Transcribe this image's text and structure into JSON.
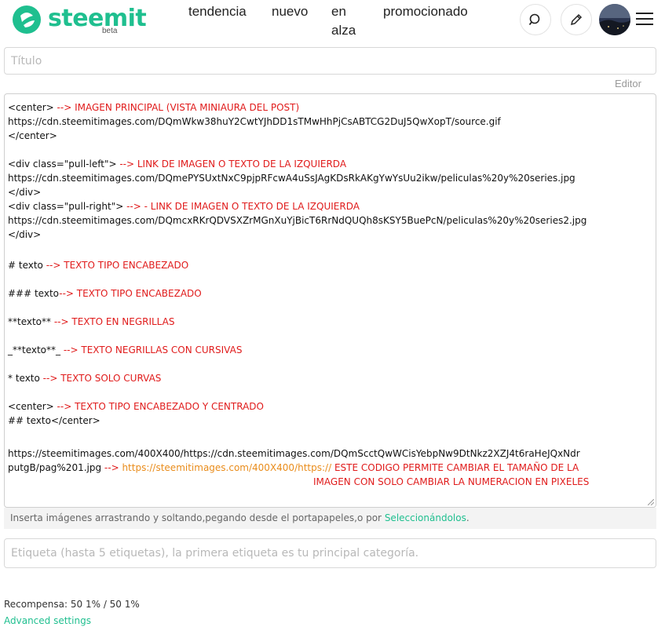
{
  "header": {
    "logo_text": "steemit",
    "logo_beta": "beta",
    "nav": [
      "tendencia",
      "nuevo",
      "en",
      "alza",
      "promocionado"
    ],
    "icons": [
      "search-icon",
      "pencil-icon",
      "avatar",
      "menu-icon"
    ]
  },
  "form": {
    "title_placeholder": "Título",
    "editor_label": "Editor",
    "body_lines": [
      {
        "plain": "<center>",
        "red": " --> IMAGEN PRINCIPAL (VISTA MINIAURA DEL POST)"
      },
      {
        "plain": "https://cdn.steemitimages.com/DQmWkw38huY2CwtYJhDD1sTMwHhPjCsABTCG2DuJ5QwXopT/source.gif"
      },
      {
        "plain": "</center>"
      },
      {
        "plain": "<div class=\"pull-left\">",
        "red": "  --> LINK DE IMAGEN O TEXTO DE LA IZQUIERDA"
      },
      {
        "plain": "https://cdn.steemitimages.com/DQmePYSUxtNxC9pjpRFcwA4uSsJAgKDsRkAKgYwYsUu2ikw/peliculas%20y%20series.jpg"
      },
      {
        "plain": "</div>"
      },
      {
        "plain": "<div class=\"pull-right\">",
        "red": " --> - LINK DE IMAGEN O TEXTO DE LA IZQUIERDA"
      },
      {
        "plain": "https://cdn.steemitimages.com/DQmcxRKrQDVSXZrMGnXuYjBicT6RrNdQUQh8sKSY5BuePcN/peliculas%20y%20series2.jpg"
      },
      {
        "plain": "</div>"
      },
      {
        "plain": " # texto",
        "red": "  --> TEXTO TIPO ENCABEZADO"
      },
      {
        "plain": " ### texto",
        "red": "--> TEXTO TIPO ENCABEZADO"
      },
      {
        "plain": " **texto**",
        "red": "  --> TEXTO EN NEGRILLAS"
      },
      {
        "plain": " _**texto**_",
        "red": "  --> TEXTO NEGRILLAS CON CURSIVAS"
      },
      {
        "plain": " * texto",
        "red": "  --> TEXTO SOLO CURVAS"
      },
      {
        "plain": " <center>",
        "red": " --> TEXTO TIPO ENCABEZADO Y CENTRADO"
      },
      {
        "plain": " ## texto</center>"
      },
      {
        "plain": "  https://steemitimages.com/400X400/https://cdn.steemitimages.com/DQmScctQwWCisYebpNw9DtNkz2XZJ4t6raHeJQxNdr"
      },
      {
        "plain": "  putgB/pag%201.jpg",
        "red": " --> ",
        "orange": "https://steemitimages.com/400X400/https://",
        "red2": " ESTE CODIGO PERMITE CAMBIAR EL TAMAÑO DE LA"
      },
      {
        "red": "IMAGEN CON SOLO CAMBIAR LA NUMERACION EN PIXELES"
      }
    ],
    "drop_hint_text": "Inserta imágenes arrastrando y soltando,pegando desde el portapapeles,o por ",
    "drop_hint_link": "Seleccionándolos",
    "drop_hint_end": ".",
    "tags_placeholder": "Etiqueta (hasta 5 etiquetas), la primera etiqueta es tu principal categoría.",
    "reward": "Recompensa: 50 1% / 50 1%",
    "advanced": "Advanced settings"
  },
  "colors": {
    "brand": "#1fbf8f",
    "annotation_red": "#e01b1b",
    "annotation_orange": "#e98c1b"
  }
}
